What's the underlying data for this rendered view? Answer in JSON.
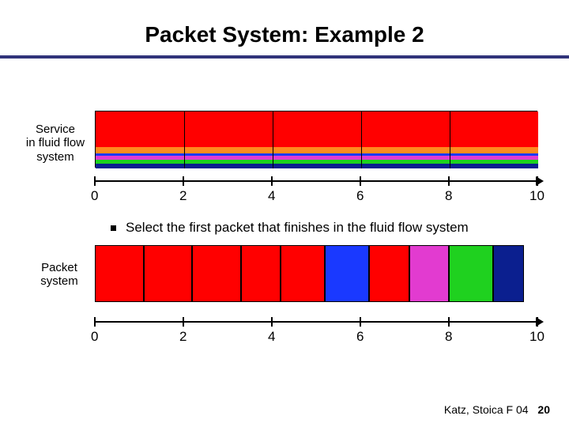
{
  "title": "Packet System: Example 2",
  "fluid": {
    "label1": "Service",
    "label2": "in fluid flow",
    "label3": "system"
  },
  "packet": {
    "label1": "Packet",
    "label2": "system"
  },
  "bullet": "Select the first packet that finishes in the fluid flow system",
  "axis": {
    "min": 0,
    "max": 10,
    "ticks": [
      0,
      2,
      4,
      6,
      8,
      10
    ]
  },
  "colors": {
    "red": "#ff0000",
    "orange": "#ff8a1f",
    "blue": "#1a39ff",
    "magenta": "#e23bd0",
    "green": "#1fd11f",
    "navy": "#0b1f8f"
  },
  "chart_data": [
    {
      "type": "area",
      "title": "Service in fluid flow system",
      "xlabel": "",
      "ylabel": "",
      "xlim": [
        0,
        10
      ],
      "ylim": [
        0,
        1
      ],
      "note": "vertical height = fraction of link capacity; each band's x-range = its service interval in the fluid system",
      "bands": [
        {
          "name": "flow-red",
          "color": "red",
          "x": [
            0,
            10
          ],
          "height": 0.62
        },
        {
          "name": "flow-orange",
          "color": "orange",
          "x": [
            0,
            10
          ],
          "height": 0.11
        },
        {
          "name": "flow-blue",
          "color": "blue",
          "x": [
            0,
            10
          ],
          "height": 0.05
        },
        {
          "name": "flow-magenta",
          "color": "magenta",
          "x": [
            0,
            10
          ],
          "height": 0.07
        },
        {
          "name": "flow-green",
          "color": "green",
          "x": [
            0,
            10
          ],
          "height": 0.06
        },
        {
          "name": "flow-navy",
          "color": "navy",
          "x": [
            0,
            10
          ],
          "height": 0.09
        }
      ],
      "dividers_x": [
        0,
        2,
        4,
        6,
        8,
        10
      ]
    },
    {
      "type": "bar",
      "title": "Packet system",
      "xlabel": "",
      "ylabel": "",
      "xlim": [
        0,
        10
      ],
      "note": "packets in transmission order; x = start/end time on the link",
      "packets": [
        {
          "name": "p1",
          "color": "red",
          "x": [
            0.0,
            1.1
          ]
        },
        {
          "name": "p2",
          "color": "red",
          "x": [
            1.1,
            2.2
          ]
        },
        {
          "name": "p3",
          "color": "red",
          "x": [
            2.2,
            3.3
          ]
        },
        {
          "name": "p4",
          "color": "red",
          "x": [
            3.3,
            4.2
          ]
        },
        {
          "name": "p5",
          "color": "red",
          "x": [
            4.2,
            5.2
          ]
        },
        {
          "name": "p6",
          "color": "blue",
          "x": [
            5.2,
            6.2
          ]
        },
        {
          "name": "p7",
          "color": "red",
          "x": [
            6.2,
            7.1
          ]
        },
        {
          "name": "p8",
          "color": "magenta",
          "x": [
            7.1,
            8.0
          ]
        },
        {
          "name": "p9",
          "color": "green",
          "x": [
            8.0,
            9.0
          ]
        },
        {
          "name": "p10",
          "color": "navy",
          "x": [
            9.0,
            9.7
          ]
        }
      ]
    }
  ],
  "footer": {
    "text": "Katz, Stoica F 04",
    "page": "20"
  }
}
